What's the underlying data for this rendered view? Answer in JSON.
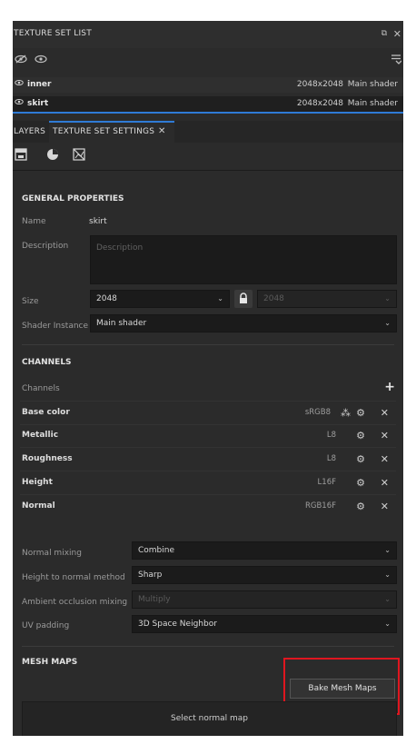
{
  "texture_set_list": {
    "title": "TEXTURE SET LIST",
    "items": [
      {
        "name": "inner",
        "resolution": "2048x2048",
        "shader": "Main shader"
      },
      {
        "name": "skirt",
        "resolution": "2048x2048",
        "shader": "Main shader"
      }
    ]
  },
  "tabs": {
    "layers": "LAYERS",
    "texture_set_settings": "TEXTURE SET SETTINGS",
    "close": "✕"
  },
  "general": {
    "title": "GENERAL PROPERTIES",
    "name_label": "Name",
    "name_value": "skirt",
    "description_label": "Description",
    "description_placeholder": "Description",
    "size_label": "Size",
    "size_value": "2048",
    "size_value_locked": "2048",
    "shader_label": "Shader Instance",
    "shader_value": "Main shader"
  },
  "channels": {
    "title": "CHANNELS",
    "header_label": "Channels",
    "add": "+",
    "items": [
      {
        "name": "Base color",
        "format": "sRGB8"
      },
      {
        "name": "Metallic",
        "format": "L8"
      },
      {
        "name": "Roughness",
        "format": "L8"
      },
      {
        "name": "Height",
        "format": "L16F"
      },
      {
        "name": "Normal",
        "format": "RGB16F"
      }
    ]
  },
  "mixing": {
    "normal_mixing_label": "Normal mixing",
    "normal_mixing_value": "Combine",
    "height_to_normal_label": "Height to normal method",
    "height_to_normal_value": "Sharp",
    "ao_mixing_label": "Ambient occlusion mixing",
    "ao_mixing_value": "Multiply",
    "uv_padding_label": "UV padding",
    "uv_padding_value": "3D Space Neighbor"
  },
  "mesh_maps": {
    "title": "MESH MAPS",
    "bake_button": "Bake Mesh Maps",
    "select_normal": "Select normal map"
  },
  "colors": {
    "highlight": "#e0161f",
    "accent": "#2f7bd6",
    "panel": "#2b2b2b"
  }
}
